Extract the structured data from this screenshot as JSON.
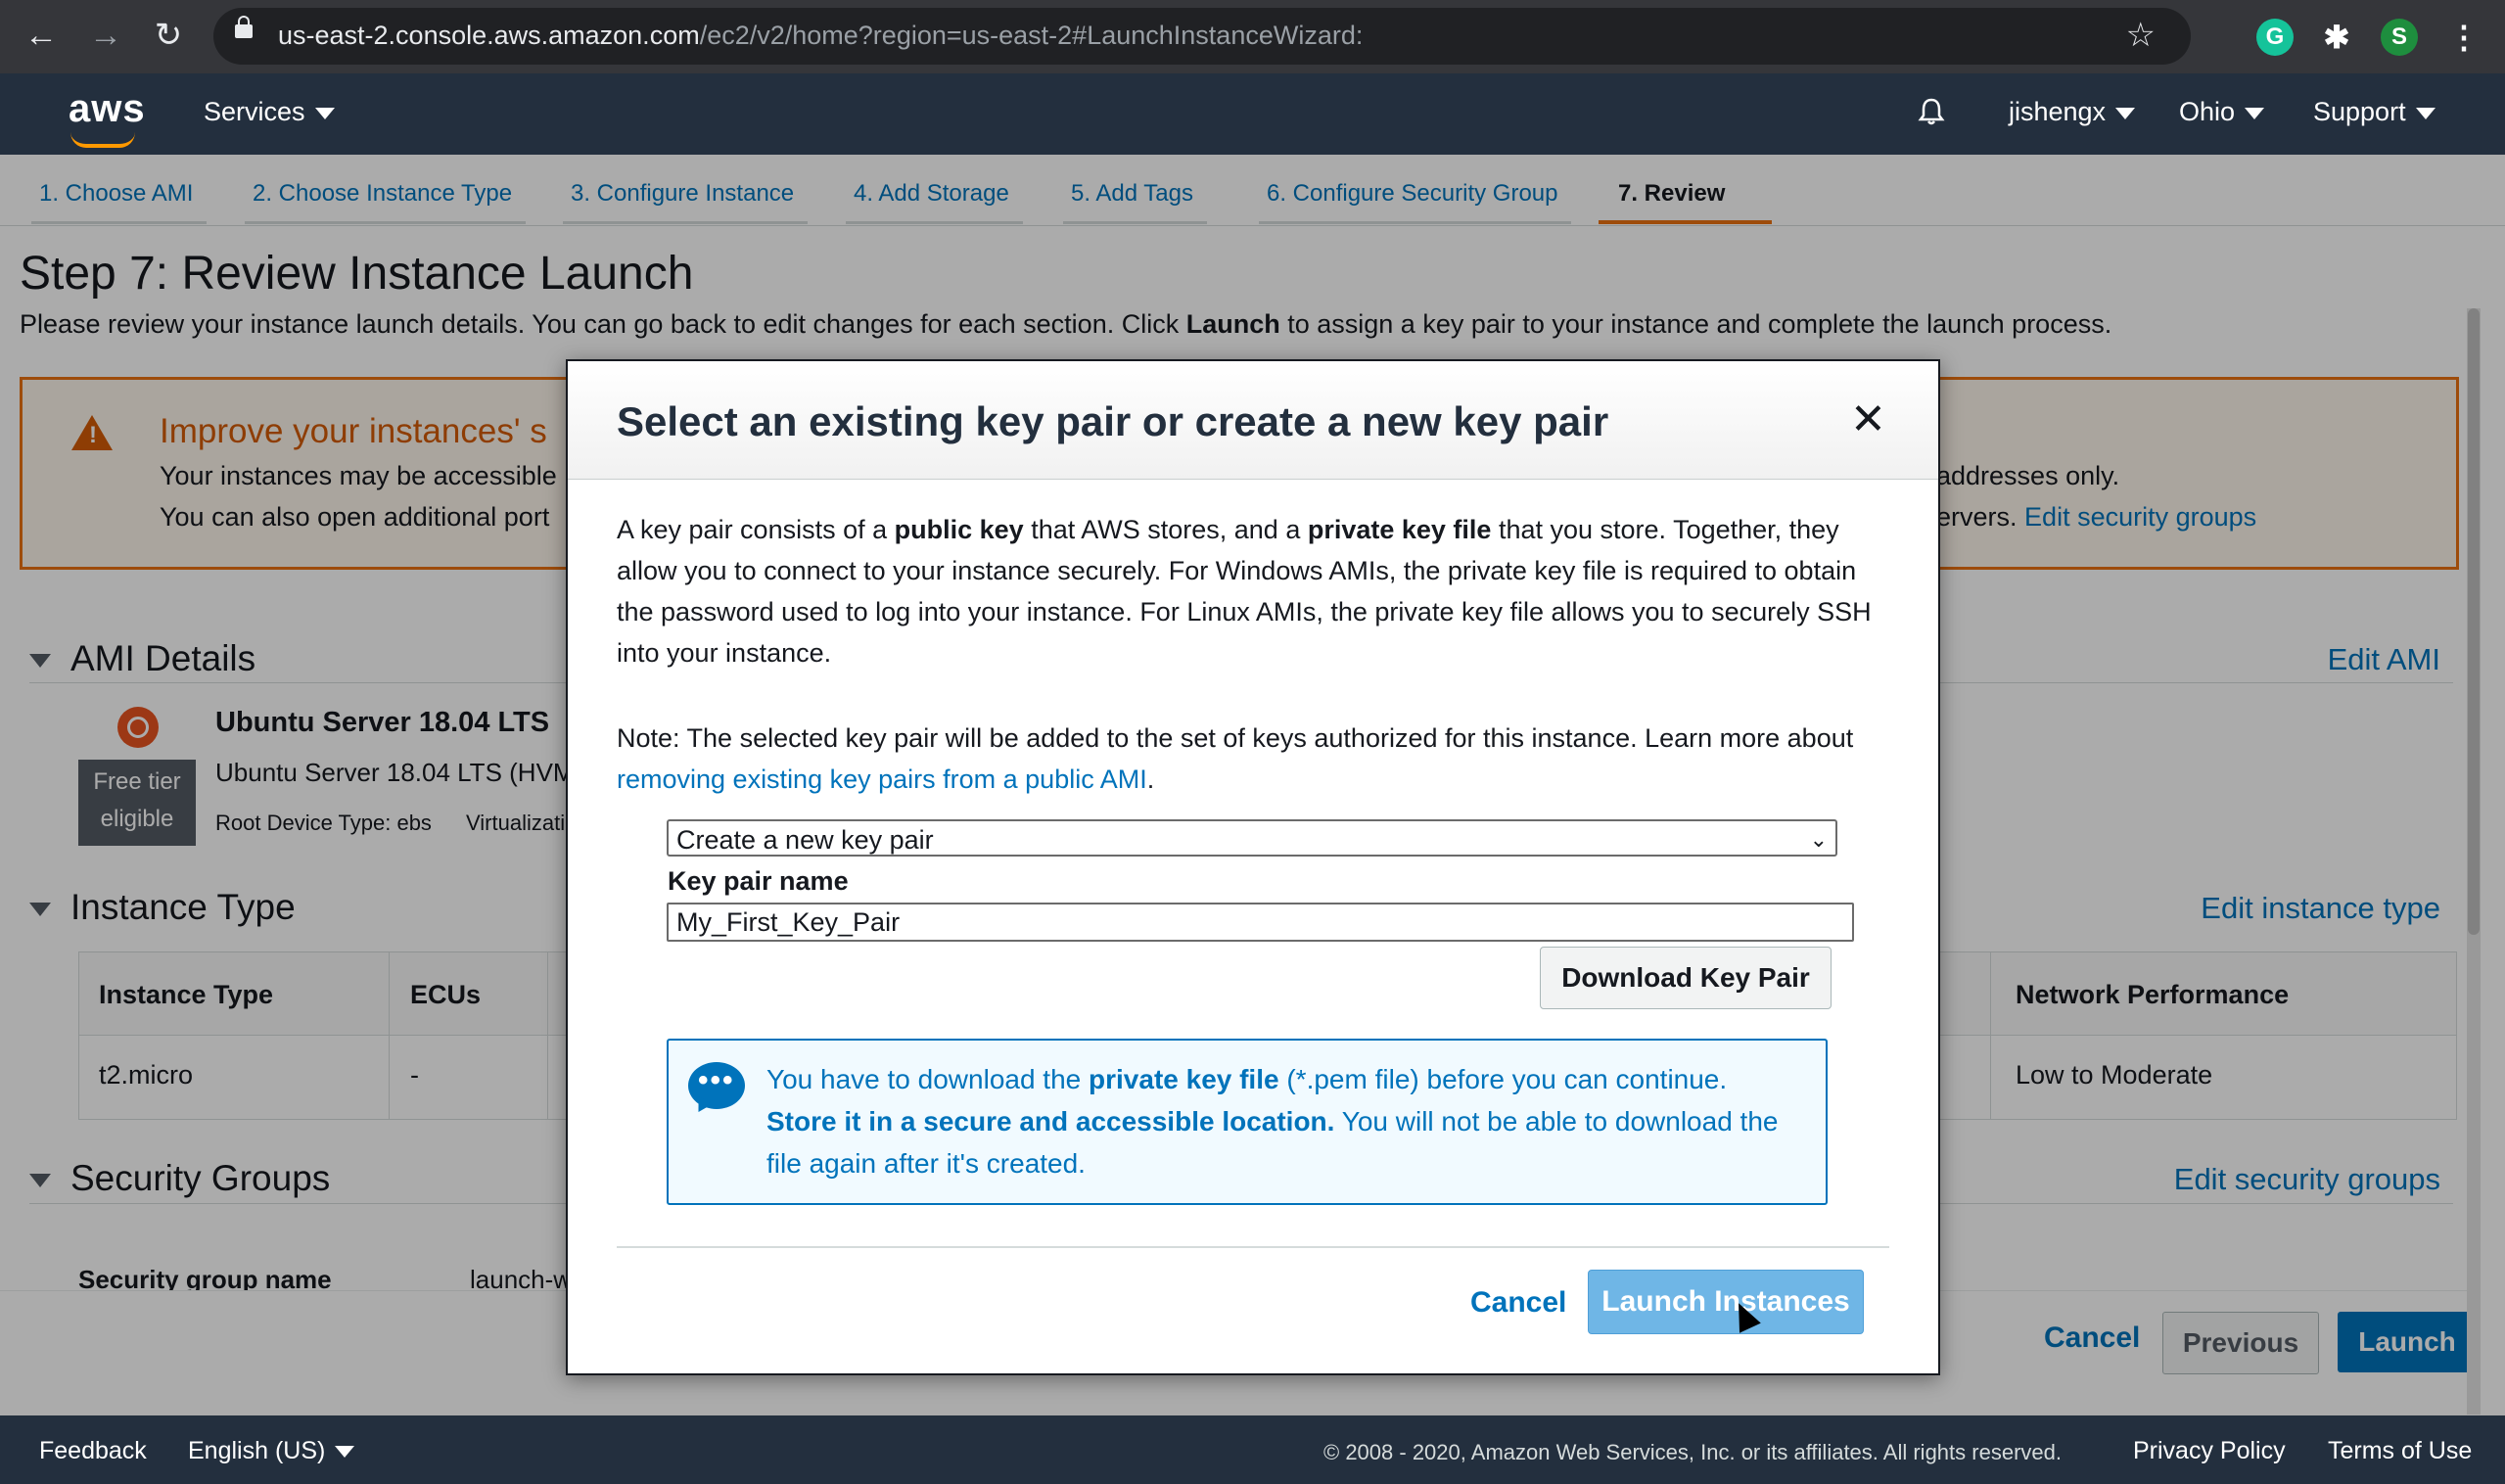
{
  "browser": {
    "url_host": "us-east-2.console.aws.amazon.com",
    "url_path": "/ec2/v2/home?region=us-east-2#LaunchInstanceWizard:",
    "ext_grammarly": "G",
    "profile_initial": "S"
  },
  "header": {
    "logo": "aws",
    "services": "Services",
    "user": "jishengx",
    "region": "Ohio",
    "support": "Support"
  },
  "wizard_tabs": [
    {
      "label": "1. Choose AMI"
    },
    {
      "label": "2. Choose Instance Type"
    },
    {
      "label": "3. Configure Instance"
    },
    {
      "label": "4. Add Storage"
    },
    {
      "label": "5. Add Tags"
    },
    {
      "label": "6. Configure Security Group"
    },
    {
      "label": "7. Review"
    }
  ],
  "page": {
    "title": "Step 7: Review Instance Launch",
    "intro_pre": "Please review your instance launch details. You can go back to edit changes for each section. Click ",
    "intro_bold": "Launch",
    "intro_post": " to assign a key pair to your instance and complete the launch process."
  },
  "warning": {
    "title": "Improve your instances' s",
    "line1": "Your instances may be accessible",
    "line2": "You can also open additional port",
    "right1": "addresses only.",
    "right2": "ervers.",
    "link": "Edit security groups"
  },
  "ami": {
    "section": "AMI Details",
    "edit": "Edit AMI",
    "name": "Ubuntu Server 18.04 LTS",
    "desc": "Ubuntu Server 18.04 LTS (HVM",
    "badge_1": "Free tier",
    "badge_2": "eligible",
    "root_device": "Root Device Type: ebs",
    "virtualization": "Virtualizati"
  },
  "instance_type": {
    "section": "Instance Type",
    "edit": "Edit instance type",
    "columns": [
      "Instance Type",
      "ECUs",
      "Network Performance"
    ],
    "row": [
      "t2.micro",
      "-",
      "Low to Moderate"
    ]
  },
  "security_groups": {
    "section": "Security Groups",
    "edit": "Edit security groups",
    "col_name": "Security group name",
    "col_value": "launch-w"
  },
  "bottom_actions": {
    "cancel": "Cancel",
    "previous": "Previous",
    "launch": "Launch"
  },
  "footer": {
    "feedback": "Feedback",
    "language": "English (US)",
    "copyright": "© 2008 - 2020, Amazon Web Services, Inc. or its affiliates. All rights reserved.",
    "privacy": "Privacy Policy",
    "terms": "Terms of Use"
  },
  "modal": {
    "title": "Select an existing key pair or create a new key pair",
    "body_1": "A key pair consists of a ",
    "body_b1": "public key",
    "body_2": " that AWS stores, and a ",
    "body_b2": "private key file",
    "body_3": " that you store. Together, they allow you to connect to your instance securely. For Windows AMIs, the private key file is required to obtain the password used to log into your instance. For Linux AMIs, the private key file allows you to securely SSH into your instance.",
    "note_pre": "Note: The selected key pair will be added to the set of keys authorized for this instance. Learn more about ",
    "note_link": "removing existing key pairs from a public AMI",
    "note_post": ".",
    "select_value": "Create a new key pair",
    "key_label": "Key pair name",
    "key_value": "My_First_Key_Pair",
    "download": "Download Key Pair",
    "info_1": "You have to download the ",
    "info_b1": "private key file",
    "info_2": " (*.pem file) before you can continue. ",
    "info_b2": "Store it in a secure and accessible location.",
    "info_3": " You will not be able to download the file again after it's created.",
    "cancel": "Cancel",
    "launch": "Launch Instances"
  }
}
